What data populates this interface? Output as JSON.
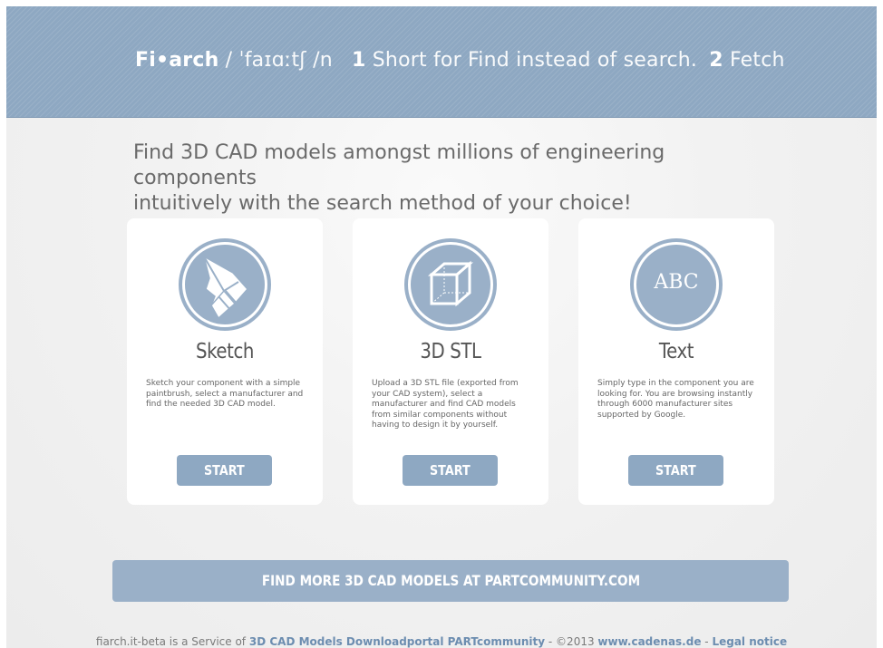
{
  "header": {
    "brand_prefix": "Fi",
    "brand_dot": "•",
    "brand_suffix": "arch",
    "pronunciation": " / ˈfaɪɑːtʃ /n",
    "def1_num": "1",
    "def1_text": " Short for Find instead of search.",
    "def2_num": "2",
    "def2_text": " Fetch"
  },
  "intro": {
    "line1": "Find 3D CAD models amongst millions of engineering components",
    "line2": "intuitively with the search method of your choice!"
  },
  "cards": [
    {
      "title": "Sketch",
      "icon": "pencil-icon",
      "description": "Sketch your component with a simple paintbrush, select a manufacturer and find the needed 3D CAD model.",
      "button": "START"
    },
    {
      "title": "3D STL",
      "icon": "cube-icon",
      "description": "Upload a 3D STL file (exported from your CAD system), select a manufacturer and find CAD models from similar components without having to design it by yourself.",
      "button": "START"
    },
    {
      "title": "Text",
      "icon": "abc-text-icon",
      "icon_text": "ABC",
      "description": "Simply type in the component you are looking for. You are browsing instantly through 6000 manufacturer sites supported by Google.",
      "button": "START"
    }
  ],
  "cta": {
    "label": "FIND MORE 3D CAD MODELS AT PARTCOMMUNITY.COM"
  },
  "footer": {
    "prefix": "fiarch.it-beta is a Service of ",
    "link1": "3D CAD Models Downloadportal PARTcommunity",
    "middle": " - ©2013 ",
    "link2": "www.cadenas.de",
    "separator": " - ",
    "link3": "Legal notice"
  },
  "colors": {
    "accent": "#8ea8c2",
    "card_bg": "#ffffff",
    "link": "#6c8db0"
  }
}
